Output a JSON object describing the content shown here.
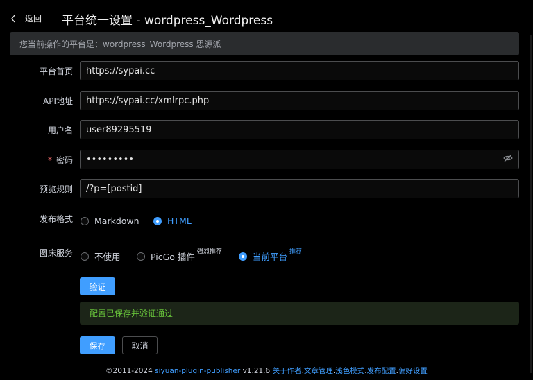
{
  "header": {
    "back_label": "返回",
    "title": "平台统一设置 - wordpress_Wordpress"
  },
  "notice": "您当前操作的平台是：wordpress_Wordpress 思源派",
  "form": {
    "home": {
      "label": "平台首页",
      "value": "https://sypai.cc"
    },
    "api": {
      "label": "API地址",
      "value": "https://sypai.cc/xmlrpc.php"
    },
    "username": {
      "label": "用户名",
      "value": "user89295519"
    },
    "password": {
      "label": "密码",
      "required_mark": "*",
      "value": "•••••••••"
    },
    "preview": {
      "label": "预览规则",
      "value": "/?p=[postid]"
    },
    "format": {
      "label": "发布格式",
      "options": [
        {
          "label": "Markdown",
          "checked": false
        },
        {
          "label": "HTML",
          "checked": true
        }
      ]
    },
    "picbed": {
      "label": "图床服务",
      "options": [
        {
          "label": "不使用",
          "tag": "",
          "checked": false
        },
        {
          "label": "PicGo 插件",
          "tag": "强烈推荐",
          "checked": false
        },
        {
          "label": "当前平台",
          "tag": "推荐",
          "checked": true
        }
      ]
    }
  },
  "verify_button": "验证",
  "success_message": "配置已保存并验证通过",
  "save_button": "保存",
  "cancel_button": "取消",
  "footer": {
    "copyright": "©2011-2024",
    "plugin_link": "siyuan-plugin-publisher",
    "version": "v1.21.6",
    "links": [
      "关于作者",
      "文章管理",
      "浅色模式",
      "发布配置",
      "偏好设置"
    ]
  },
  "colors": {
    "accent": "#409eff",
    "success": "#67c23a",
    "required": "#f56c6c",
    "background": "#000000"
  }
}
